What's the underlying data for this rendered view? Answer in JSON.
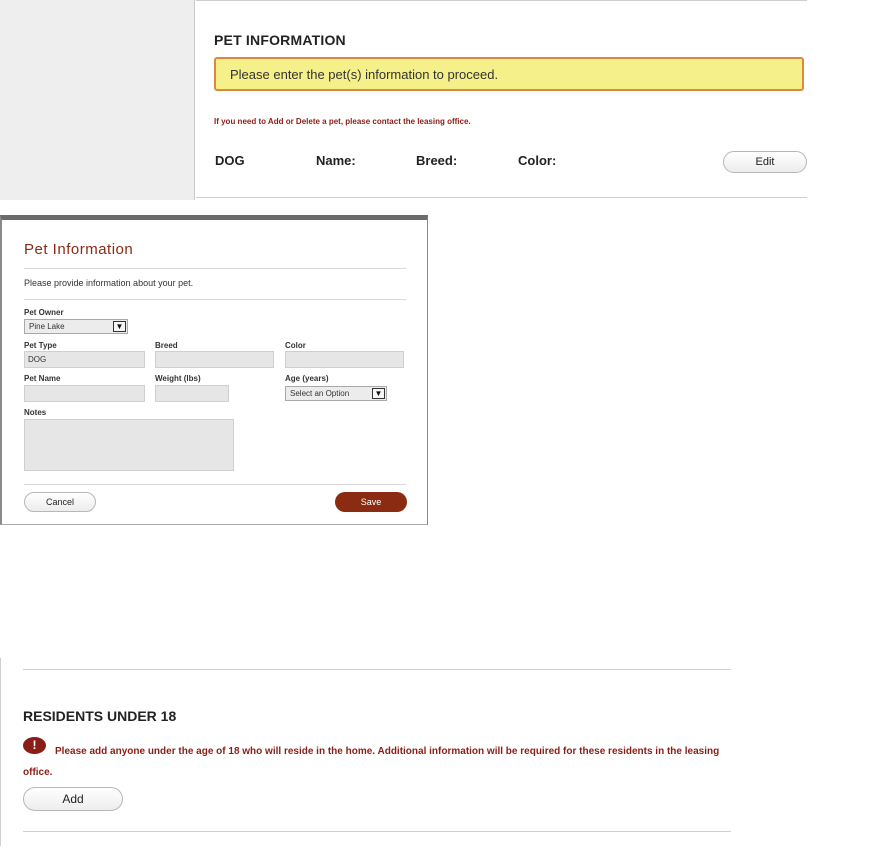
{
  "pet_section": {
    "heading": "PET INFORMATION",
    "notice": "Please enter the pet(s) information to proceed.",
    "contact_note": "If you need to Add or Delete a pet, please contact the leasing office.",
    "pet_type": "DOG",
    "name_label": "Name:",
    "breed_label": "Breed:",
    "color_label": "Color:",
    "edit_button": "Edit"
  },
  "modal": {
    "title": "Pet Information",
    "description": "Please provide information about your pet.",
    "fields": {
      "pet_owner": {
        "label": "Pet Owner",
        "value": "Pine Lake"
      },
      "pet_type": {
        "label": "Pet Type",
        "value": "DOG"
      },
      "breed": {
        "label": "Breed",
        "value": ""
      },
      "color": {
        "label": "Color",
        "value": ""
      },
      "pet_name": {
        "label": "Pet Name",
        "value": ""
      },
      "weight": {
        "label": "Weight (lbs)",
        "value": ""
      },
      "age": {
        "label": "Age (years)",
        "value": "Select an Option"
      },
      "notes": {
        "label": "Notes",
        "value": ""
      }
    },
    "cancel_button": "Cancel",
    "save_button": "Save"
  },
  "residents_section": {
    "heading": "RESIDENTS UNDER 18",
    "alert_icon": "!",
    "note": "Please add anyone under the age of 18 who will reside in the home. Additional information will be required for these residents in the leasing office.",
    "add_button": "Add"
  },
  "colors": {
    "accent": "#8a2b12",
    "alert_text": "#8a1e16",
    "notice_bg": "#f5f08a",
    "notice_border": "#e0873e"
  }
}
